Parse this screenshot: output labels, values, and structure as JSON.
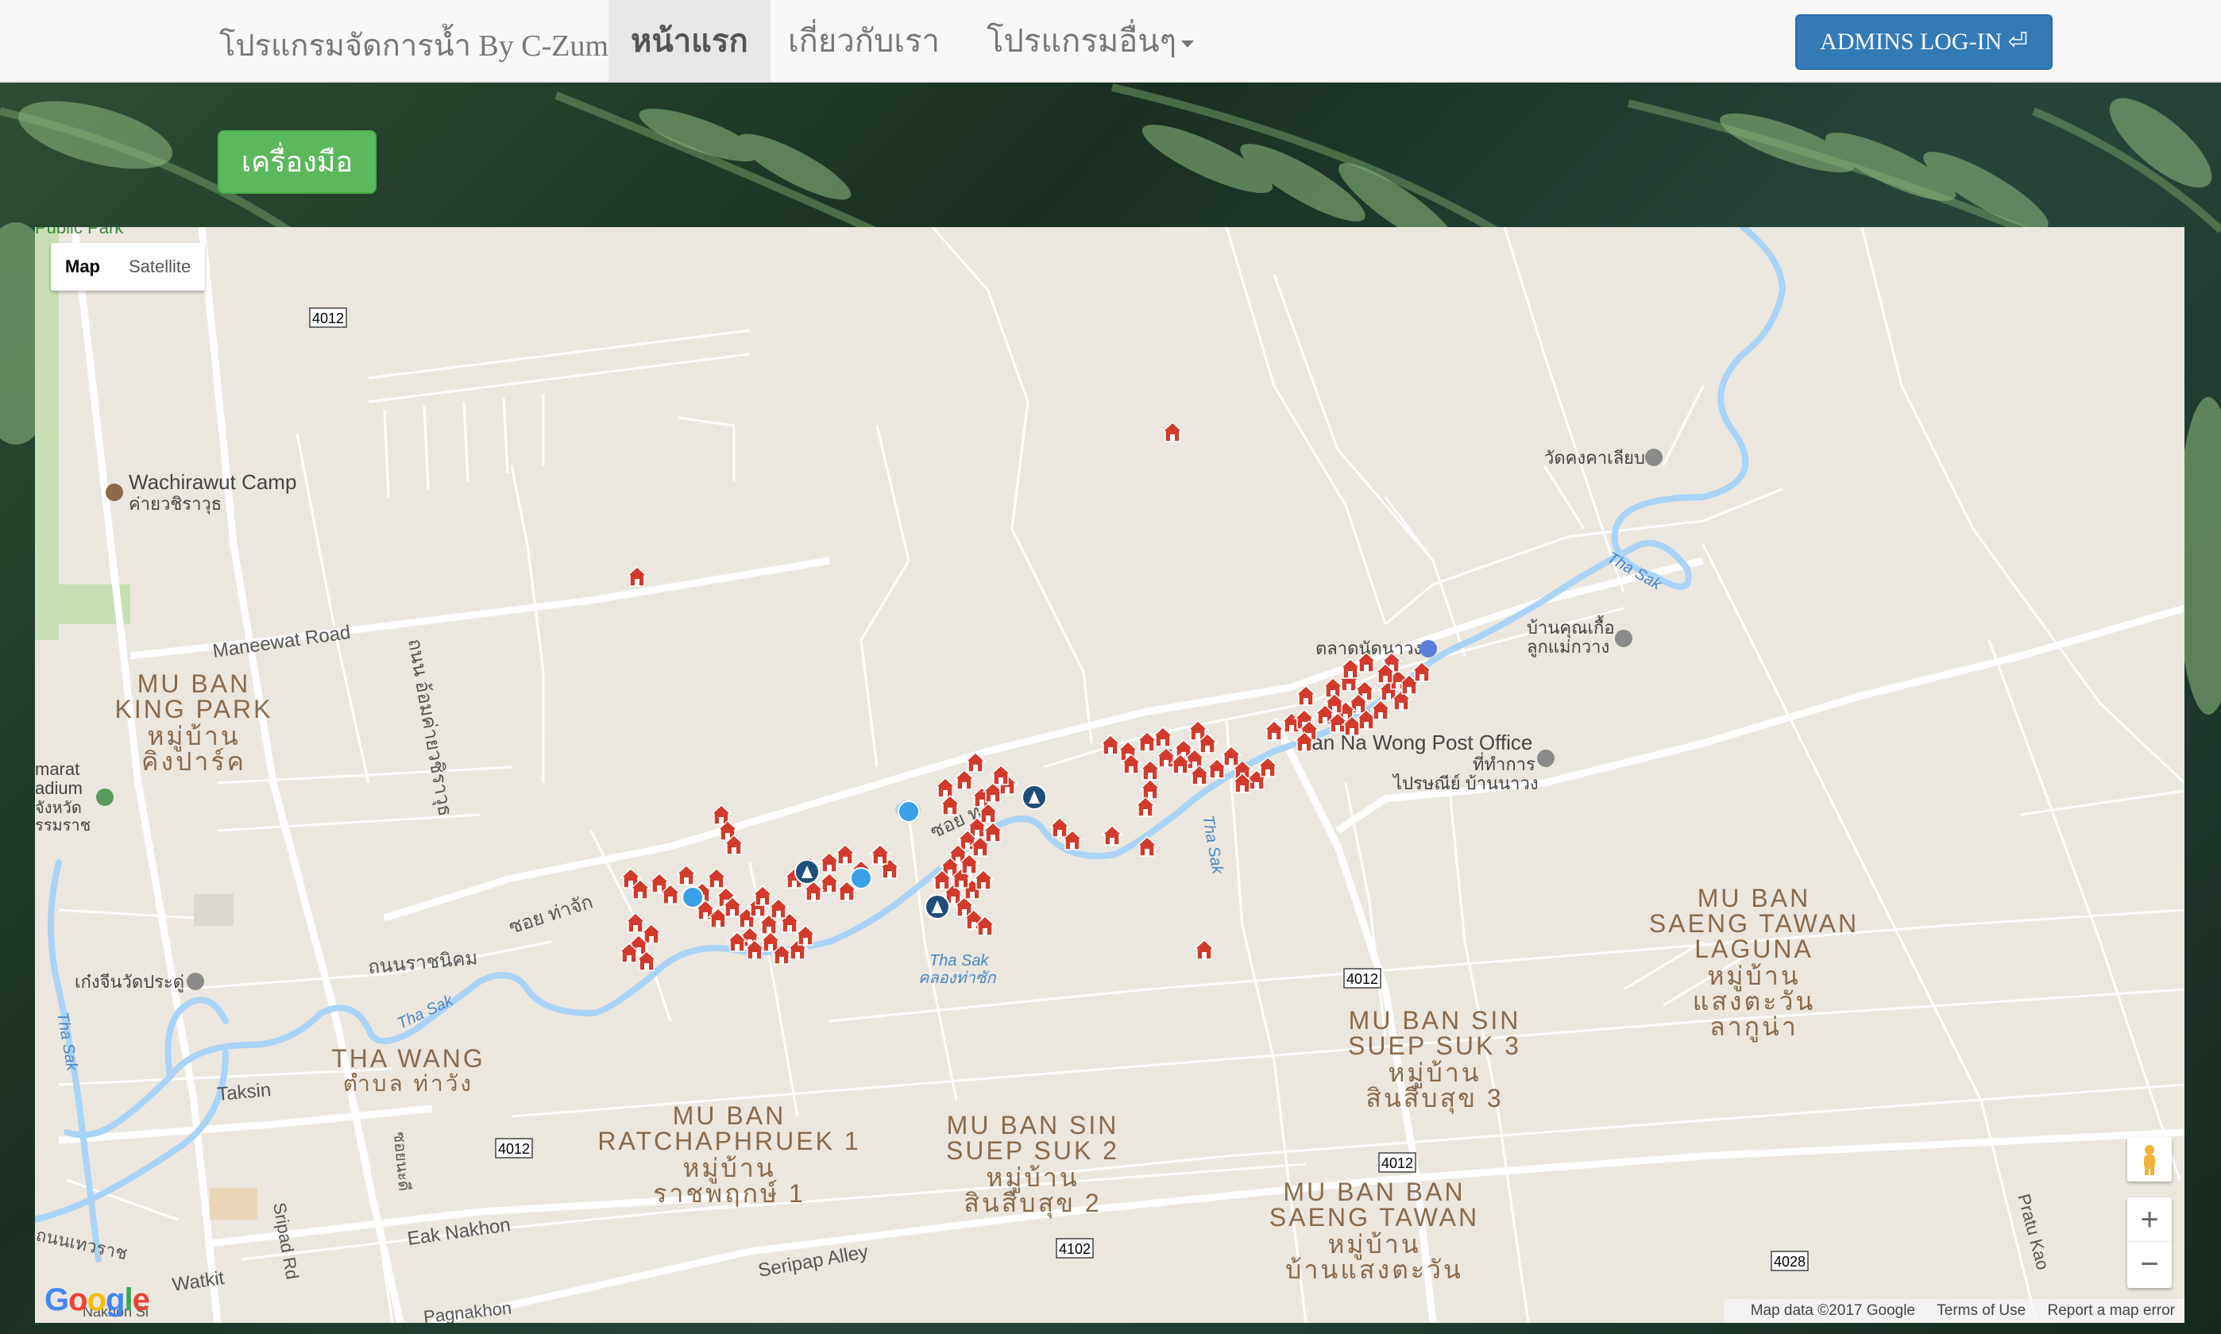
{
  "navbar": {
    "brand": "โปรแกรมจัดการน้ำ By C-Zume",
    "items": [
      {
        "label": "หน้าแรก",
        "active": true
      },
      {
        "label": "เกี่ยวกับเรา",
        "active": false
      },
      {
        "label": "โปรแกรมอื่นๆ",
        "active": false,
        "dropdown": true
      }
    ],
    "admin_button": "ADMINS LOG-IN ⏎"
  },
  "tools_button": "เครื่องมือ",
  "map": {
    "type_control": {
      "map": "Map",
      "satellite": "Satellite",
      "selected": "Map"
    },
    "zoom_in": "+",
    "zoom_out": "−",
    "google_logo": "Google",
    "attribution": {
      "data": "Map data ©2017 Google",
      "terms": "Terms of Use",
      "report": "Report a map error"
    },
    "labels": {
      "public_park": "Public Park",
      "wachirawut_camp": "Wachirawut Camp",
      "wachirawut_camp_th": "ค่ายวชิราวุธ",
      "maneewat_road": "Maneewat Road",
      "mu_ban_king_park": "MU BAN",
      "mu_ban_king_park_2": "KING PARK",
      "mu_ban_king_park_th": "หมู่บ้าน",
      "mu_ban_king_park_th2": "คิงปาร์ค",
      "stadium": "marat",
      "stadium2": "adium",
      "stadium_th": "จังหวัด",
      "stadium_th2": "รรมราช",
      "road_4012_a": "4012",
      "road_4012_b": "4012",
      "road_4012_c": "4012",
      "road_4012_d": "4012",
      "road_4028": "4028",
      "road_4102": "4102",
      "vertical_road_th": "ถนน อ้อมค่ายวชิราวุธ",
      "soi_tha_chak": "ซอย ท่าจัก",
      "soi_tha_2": "ซอย ท่",
      "thanon_ratchanikhom": "ถนนราชนิคม",
      "kengchin": "เก๋งจีนวัดประดู่",
      "tha_sak_1": "Tha Sak",
      "tha_sak_2": "Tha Sak",
      "tha_sak_3": "Tha Sak",
      "tha_sak_th": "คลองท่าซัก",
      "tha_sak_v": "Tha Sak",
      "tha_sak_left": "Tha Sak",
      "tha_wang": "THA WANG",
      "tha_wang_th": "ตำบล ท่าวัง",
      "taksin": "Taksin",
      "soi_vertical": "ซอยนะดี",
      "sripad": "Sripad Rd",
      "eak_nakhon": "Eak Nakhon",
      "watkit": "Watkit",
      "seripap": "Seripap Alley",
      "pagnakhon": "Pagnakhon",
      "nakhonsi": "Nakhon Si",
      "thanon_thewarat": "ถนนเทวราช",
      "ratchaphruek": "MU BAN",
      "ratchaphruek2": "RATCHAPHRUEK 1",
      "ratchaphruek_th": "หมู่บ้าน",
      "ratchaphruek_th2": "ราชพฤกษ์ 1",
      "sinsuep2": "MU BAN SIN",
      "sinsuep2b": "SUEP SUK 2",
      "sinsuep2_th": "หมู่บ้าน",
      "sinsuep2_th2": "สินสืบสุข 2",
      "sinsuep3": "MU BAN SIN",
      "sinsuep3b": "SUEP SUK 3",
      "sinsuep3_th": "หมู่บ้าน",
      "sinsuep3_th2": "สินสืบสุข 3",
      "bansaeng": "MU BAN BAN",
      "bansaeng2": "SAENG TAWAN",
      "bansaeng_th": "หมู่บ้าน",
      "bansaeng_th2": "บ้านแสงตะวัน",
      "laguna": "MU BAN",
      "laguna2": "SAENG TAWAN",
      "laguna3": "LAGUNA",
      "laguna_th": "หมู่บ้าน",
      "laguna_th2": "แสงตะวัน",
      "laguna_th3": "ลากูน่า",
      "post_office": "Ban Na Wong Post Office",
      "post_office_th": "ที่ทำการ",
      "post_office_th2": "ไปรษณีย์ บ้านนาวง",
      "market_th": "ตลาดนัดนาวง",
      "wat_th": "วัดคงคาเลียบ",
      "bankhun_th": "บ้านคุณเกื้อ",
      "bankhun_th2": "ลูกแม่กวาง",
      "pratu_kao": "Pratu Kao",
      "soi_r": "ร"
    }
  },
  "colors": {
    "navbar_bg": "#f8f8f8",
    "primary": "#337ab7",
    "success": "#5cb85c",
    "map_bg": "#ebe7df",
    "water": "#a9d3f7",
    "marker_red": "#d23a2c"
  }
}
